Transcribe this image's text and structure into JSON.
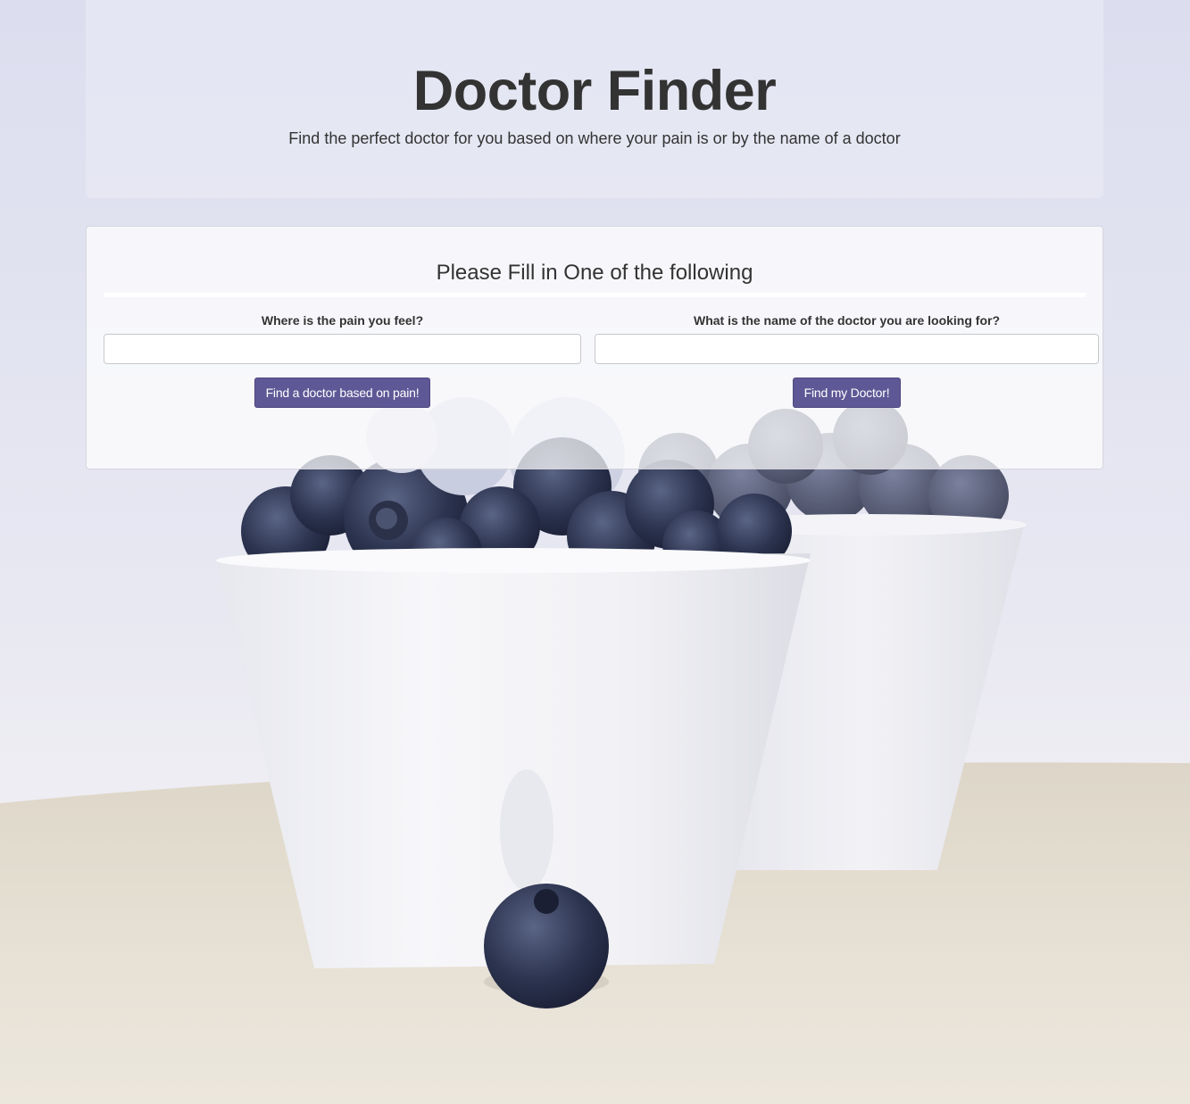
{
  "header": {
    "title": "Doctor Finder",
    "subtitle": "Find the perfect doctor for you based on where your pain is or by the name of a doctor"
  },
  "form": {
    "heading": "Please Fill in One of the following",
    "pain": {
      "label": "Where is the pain you feel?",
      "value": "",
      "button_label": "Find a doctor based on pain!"
    },
    "doctor": {
      "label": "What is the name of the doctor you are looking for?",
      "value": "",
      "button_label": "Find my Doctor!"
    }
  },
  "colors": {
    "button_bg": "#5f5896",
    "text": "#333333",
    "background": "#e3e4f0"
  },
  "background_image": "blueberries-in-white-bowls"
}
